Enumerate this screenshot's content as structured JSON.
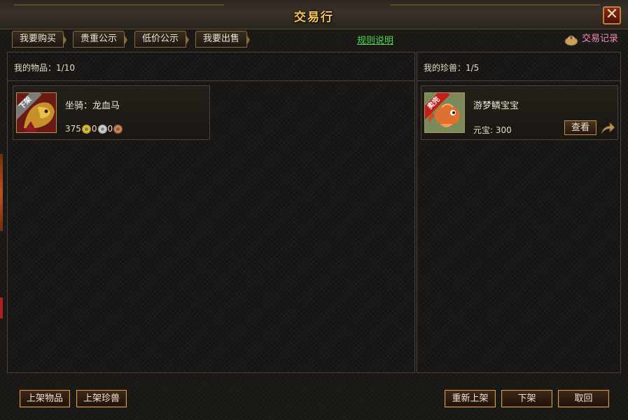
{
  "window": {
    "title": "交易行",
    "close_label": "✕"
  },
  "tabs": [
    {
      "label": "我要购买"
    },
    {
      "label": "贵重公示"
    },
    {
      "label": "低价公示"
    },
    {
      "label": "我要出售"
    }
  ],
  "rules_link": "规则说明",
  "trade_record": {
    "label": "交易记录",
    "icon": "bag-icon"
  },
  "my_items": {
    "header": "我的物品：1/10",
    "items": [
      {
        "name": "坐骑：龙血马",
        "badge": "下架",
        "gold": "375",
        "silver": "0",
        "copper": "0"
      }
    ]
  },
  "my_pets": {
    "header": "我的珍兽：1/5",
    "items": [
      {
        "name": "游梦鳞宝宝",
        "badge": "卖完",
        "price_text": "元宝:  300",
        "view_label": "查看"
      }
    ]
  },
  "buttons": {
    "list_item": "上架物品",
    "list_pet": "上架珍兽",
    "relist": "重新上架",
    "delist": "下架",
    "cancel": "取回"
  },
  "colors": {
    "title": "#f6c65a",
    "rules_link": "#4fd84f",
    "record_link": "#f08cbc",
    "button_border": "#d09a50"
  }
}
